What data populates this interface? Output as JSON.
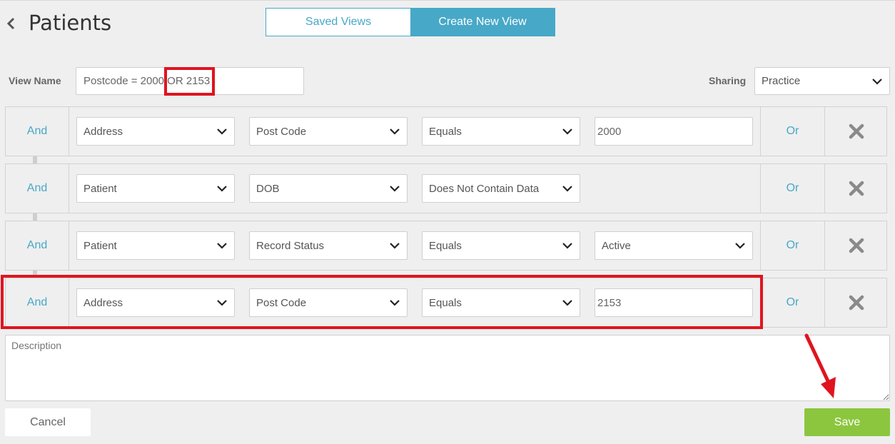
{
  "header": {
    "title": "Patients",
    "tabs": [
      "Saved Views",
      "Create New View"
    ]
  },
  "view_name": {
    "label": "View Name",
    "value": "Postcode = 2000 OR 2153"
  },
  "sharing": {
    "label": "Sharing",
    "value": "Practice"
  },
  "filters": [
    {
      "conj": "And",
      "field": "Address",
      "sub": "Post Code",
      "op": "Equals",
      "value": "2000",
      "value_type": "text",
      "or": "Or"
    },
    {
      "conj": "And",
      "field": "Patient",
      "sub": "DOB",
      "op": "Does Not Contain Data",
      "value": "",
      "value_type": "none",
      "or": "Or"
    },
    {
      "conj": "And",
      "field": "Patient",
      "sub": "Record Status",
      "op": "Equals",
      "value": "Active",
      "value_type": "select",
      "or": "Or"
    },
    {
      "conj": "And",
      "field": "Address",
      "sub": "Post Code",
      "op": "Equals",
      "value": "2153",
      "value_type": "text",
      "or": "Or"
    }
  ],
  "description": {
    "placeholder": "Description"
  },
  "buttons": {
    "cancel": "Cancel",
    "save": "Save"
  },
  "colors": {
    "accent": "#47a8c8",
    "save": "#8cc63f",
    "highlight": "#e0141f"
  }
}
